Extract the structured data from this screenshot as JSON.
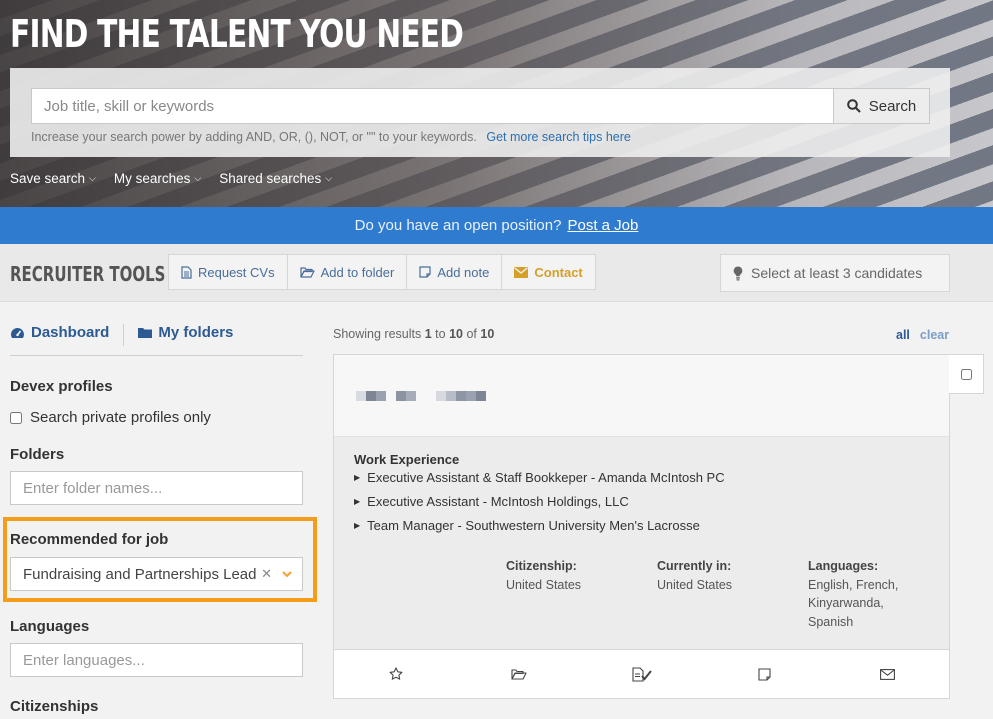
{
  "hero": {
    "title": "FIND THE TALENT YOU NEED",
    "search_placeholder": "Job title, skill or keywords",
    "search_button": "Search",
    "tips_text": "Increase your search power by adding AND, OR, (), NOT, or \"\" to your keywords.",
    "tips_link": "Get more search tips here",
    "links": [
      "Save search",
      "My searches",
      "Shared searches"
    ]
  },
  "post_bar": {
    "question": "Do you have an open position?",
    "link": "Post a Job"
  },
  "tools": {
    "title": "RECRUITER TOOLS",
    "buttons": [
      {
        "label": "Request CVs",
        "icon": "document-icon"
      },
      {
        "label": "Add to folder",
        "icon": "folder-open-icon"
      },
      {
        "label": "Add note",
        "icon": "note-icon"
      },
      {
        "label": "Contact",
        "icon": "envelope-icon"
      }
    ],
    "hint": "Select at least 3 candidates"
  },
  "sidebar": {
    "tabs": [
      "Dashboard",
      "My folders"
    ],
    "devex_profiles": "Devex profiles",
    "private_only": "Search private profiles only",
    "folders": "Folders",
    "folders_placeholder": "Enter folder names...",
    "recommended": "Recommended for job",
    "recommended_value": "Fundraising and Partnerships Lead",
    "languages": "Languages",
    "languages_placeholder": "Enter languages...",
    "citizenships": "Citizenships"
  },
  "results": {
    "prefix": "Showing results",
    "from": "1",
    "to_word": "to",
    "to": "10",
    "of_word": "of",
    "total": "10",
    "select_all": "all",
    "select_clear": "clear"
  },
  "card": {
    "work_experience_title": "Work Experience",
    "experiences": [
      "Executive Assistant & Staff Bookkeper - Amanda McIntosh PC",
      "Executive Assistant - McIntosh Holdings, LLC",
      "Team Manager - Southwestern University Men's Lacrosse"
    ],
    "citizenship_label": "Citizenship:",
    "citizenship": "United States",
    "current_label": "Currently in:",
    "current": "United States",
    "languages_label": "Languages:",
    "languages_1": "English, French,",
    "languages_2": "Kinyarwanda,",
    "languages_3": "Spanish"
  },
  "colors": {
    "accent_blue": "#2e7bd0",
    "link_blue": "#2d5a92",
    "highlight_orange": "#f59c1a",
    "contact_gold": "#d4a02a"
  }
}
